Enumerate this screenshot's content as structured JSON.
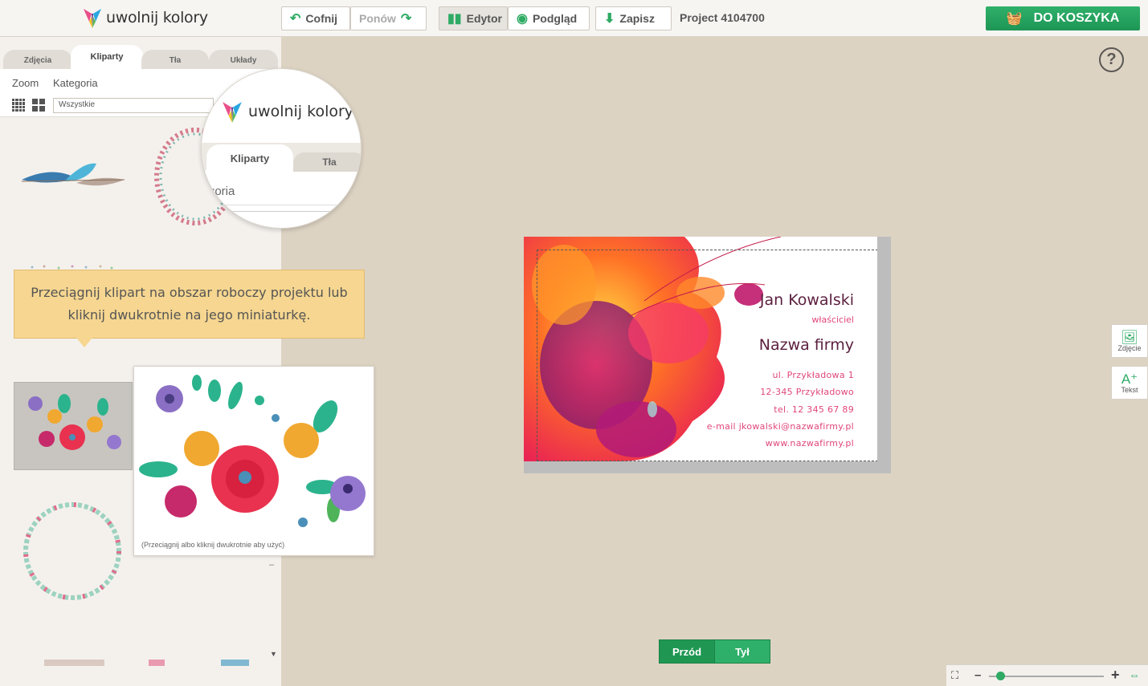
{
  "header": {
    "logo_text": "uwolnij kolory",
    "undo_label": "Cofnij",
    "redo_label": "Ponów",
    "editor_label": "Edytor",
    "preview_label": "Podgląd",
    "save_label": "Zapisz",
    "project_name": "Project 4104700",
    "cart_label": "DO KOSZYKA"
  },
  "sidebar": {
    "tabs": [
      "Zdjęcia",
      "Kliparty",
      "Tła",
      "Układy"
    ],
    "active_tab": "Kliparty",
    "zoom_label": "Zoom",
    "category_label": "Kategoria",
    "category_value": "Wszystkie",
    "magnifier": {
      "logo_text": "uwolnij kolory",
      "tab_active": "Kliparty",
      "tab_next": "Tła",
      "partial_text": "goria"
    },
    "tooltip_text": "Przeciągnij klipart na obszar roboczy projektu lub kliknij dwukrotnie na jego miniaturkę.",
    "preview_caption": "(Przeciągnij albo kliknij dwukrotnie aby użyć)",
    "scroll_down_glyph": "▼",
    "minus_glyph": "–"
  },
  "card": {
    "name": "Jan Kowalski",
    "role": "właściciel",
    "company": "Nazwa firmy",
    "lines": [
      "ul. Przykładowa 1",
      "12-345 Przykładowo",
      "tel. 12 345 67 89",
      "e-mail jkowalski@nazwafirmy.pl",
      "www.nazwafirmy.pl"
    ]
  },
  "tools": {
    "photo_label": "Zdjęcie",
    "text_label": "Tekst"
  },
  "sides": {
    "front_label": "Przód",
    "back_label": "Tył"
  },
  "help_glyph": "?",
  "zoom": {
    "minus": "–",
    "plus": "+",
    "level": 0.1
  },
  "colors": {
    "accent": "#2eaa64",
    "tooltip": "#f6d690",
    "workspace": "#ddd3c3",
    "card_name": "#5b1f3e",
    "card_accent": "#e0477a"
  }
}
